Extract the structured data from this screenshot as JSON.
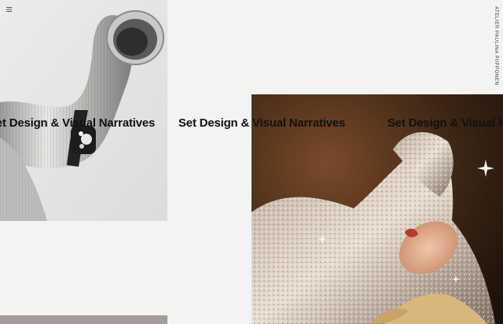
{
  "header": {
    "menu_icon": "hamburger-icon",
    "brand": "ATELIER PAULINA PIIPPONEN"
  },
  "marquee": {
    "items": [
      "Set Design & Visual Narratives",
      "Set Design & Visual Narratives",
      "Set Design & Visual Narratives"
    ]
  },
  "colors": {
    "background": "#f3f3f2",
    "text": "#111111",
    "glitter_bg": "#3a2414",
    "bottom_tile": "#a39c97"
  }
}
